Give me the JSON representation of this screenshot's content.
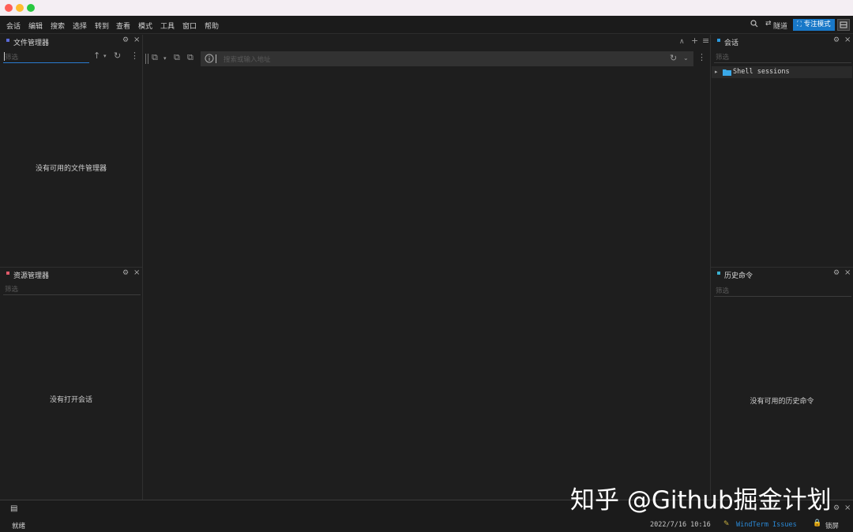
{
  "colors": {
    "accent": "#1878c8",
    "light_red": "#ff5f57",
    "light_yellow": "#febc2e",
    "light_green": "#28c840",
    "file_dot": "#5a6ad8",
    "resource_dot": "#e05a6a",
    "session_dot": "#2a9ae0",
    "history_dot": "#3ab0d0",
    "link": "#2a8ad8"
  },
  "menu": {
    "items": [
      "会话",
      "编辑",
      "搜索",
      "选择",
      "转到",
      "查看",
      "模式",
      "工具",
      "窗口",
      "帮助"
    ],
    "tunnel_label": "隧道",
    "focus_mode_label": "专注模式"
  },
  "file_manager": {
    "title": "文件管理器",
    "filter_placeholder": "筛选",
    "empty_text": "没有可用的文件管理器"
  },
  "resource_manager": {
    "title": "资源管理器",
    "filter_placeholder": "筛选",
    "empty_text": "没有打开会话"
  },
  "sessions": {
    "title": "会话",
    "filter_placeholder": "筛选",
    "tree_item": "Shell sessions"
  },
  "history": {
    "title": "历史命令",
    "filter_placeholder": "筛选",
    "empty_text": "没有可用的历史命令"
  },
  "address_bar": {
    "placeholder": "搜索或输入地址"
  },
  "status": {
    "ready": "就绪",
    "datetime": "2022/7/16 10:16",
    "issues_link": "WindTerm Issues",
    "lock_label": "锁屏"
  },
  "watermark": "知乎 @Github掘金计划",
  "icons": {
    "search": "search-icon",
    "tunnel": "tunnel-icon",
    "gear": "gear-icon",
    "close": "close-icon",
    "up": "up-arrow-icon",
    "refresh": "refresh-icon",
    "more": "more-icon",
    "info": "info-icon",
    "folder": "folder-icon",
    "lock": "lock-icon"
  }
}
